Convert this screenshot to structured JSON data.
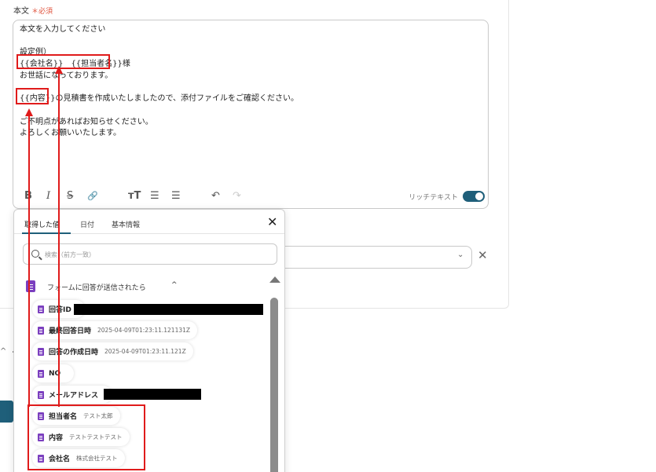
{
  "field": {
    "label": "本文",
    "required_mark": "＊必須"
  },
  "editor": {
    "lines": [
      "本文を入力してください",
      "",
      "設定例）",
      "{{会社名}}　{{担当者名}}様",
      "お世話になっております。",
      "",
      "{{内容}}の見積書を作成いたしましたので、添付ファイルをご確認ください。",
      "",
      "ご不明点があればお知らせください。",
      "よろしくお願いいたします。"
    ],
    "toolbar": {
      "bold": "B",
      "italic": "I",
      "strike": "S",
      "link": "🔗",
      "text_size": "ᴛT",
      "bullet_list": "☰",
      "ordered_list": "☰",
      "undo": "↶",
      "redo": "↷"
    },
    "rich_text_label": "リッチテキスト",
    "rich_text_enabled": true
  },
  "popup": {
    "tabs": [
      {
        "label": "取得した値",
        "active": true
      },
      {
        "label": "日付",
        "active": false
      },
      {
        "label": "基本情報",
        "active": false
      }
    ],
    "close_glyph": "✕",
    "search": {
      "placeholder": "検索（前方一致）",
      "value": ""
    },
    "section": {
      "label": "フォームに回答が送信されたら",
      "chevron": "^"
    },
    "items": [
      {
        "label": "回答ID",
        "value": "",
        "redacted": true
      },
      {
        "label": "最終回答日時",
        "value": "2025-04-09T01:23:11.121131Z"
      },
      {
        "label": "回答の作成日時",
        "value": "2025-04-09T01:23:11.121Z"
      },
      {
        "label": "NO",
        "value": ""
      },
      {
        "label": "メールアドレス",
        "value": "",
        "redacted": true
      },
      {
        "label": "担当者名",
        "value": "テスト太郎"
      },
      {
        "label": "内容",
        "value": "テストテストテスト"
      },
      {
        "label": "会社名",
        "value": "株式会社テスト"
      }
    ]
  },
  "dropdown": {
    "chevron": "⌄",
    "clear_glyph": "✕"
  },
  "colors": {
    "accent": "#1f5f7a",
    "required": "#e0533d",
    "form_icon": "#7b3fbf",
    "highlight": "#e01b1b"
  }
}
